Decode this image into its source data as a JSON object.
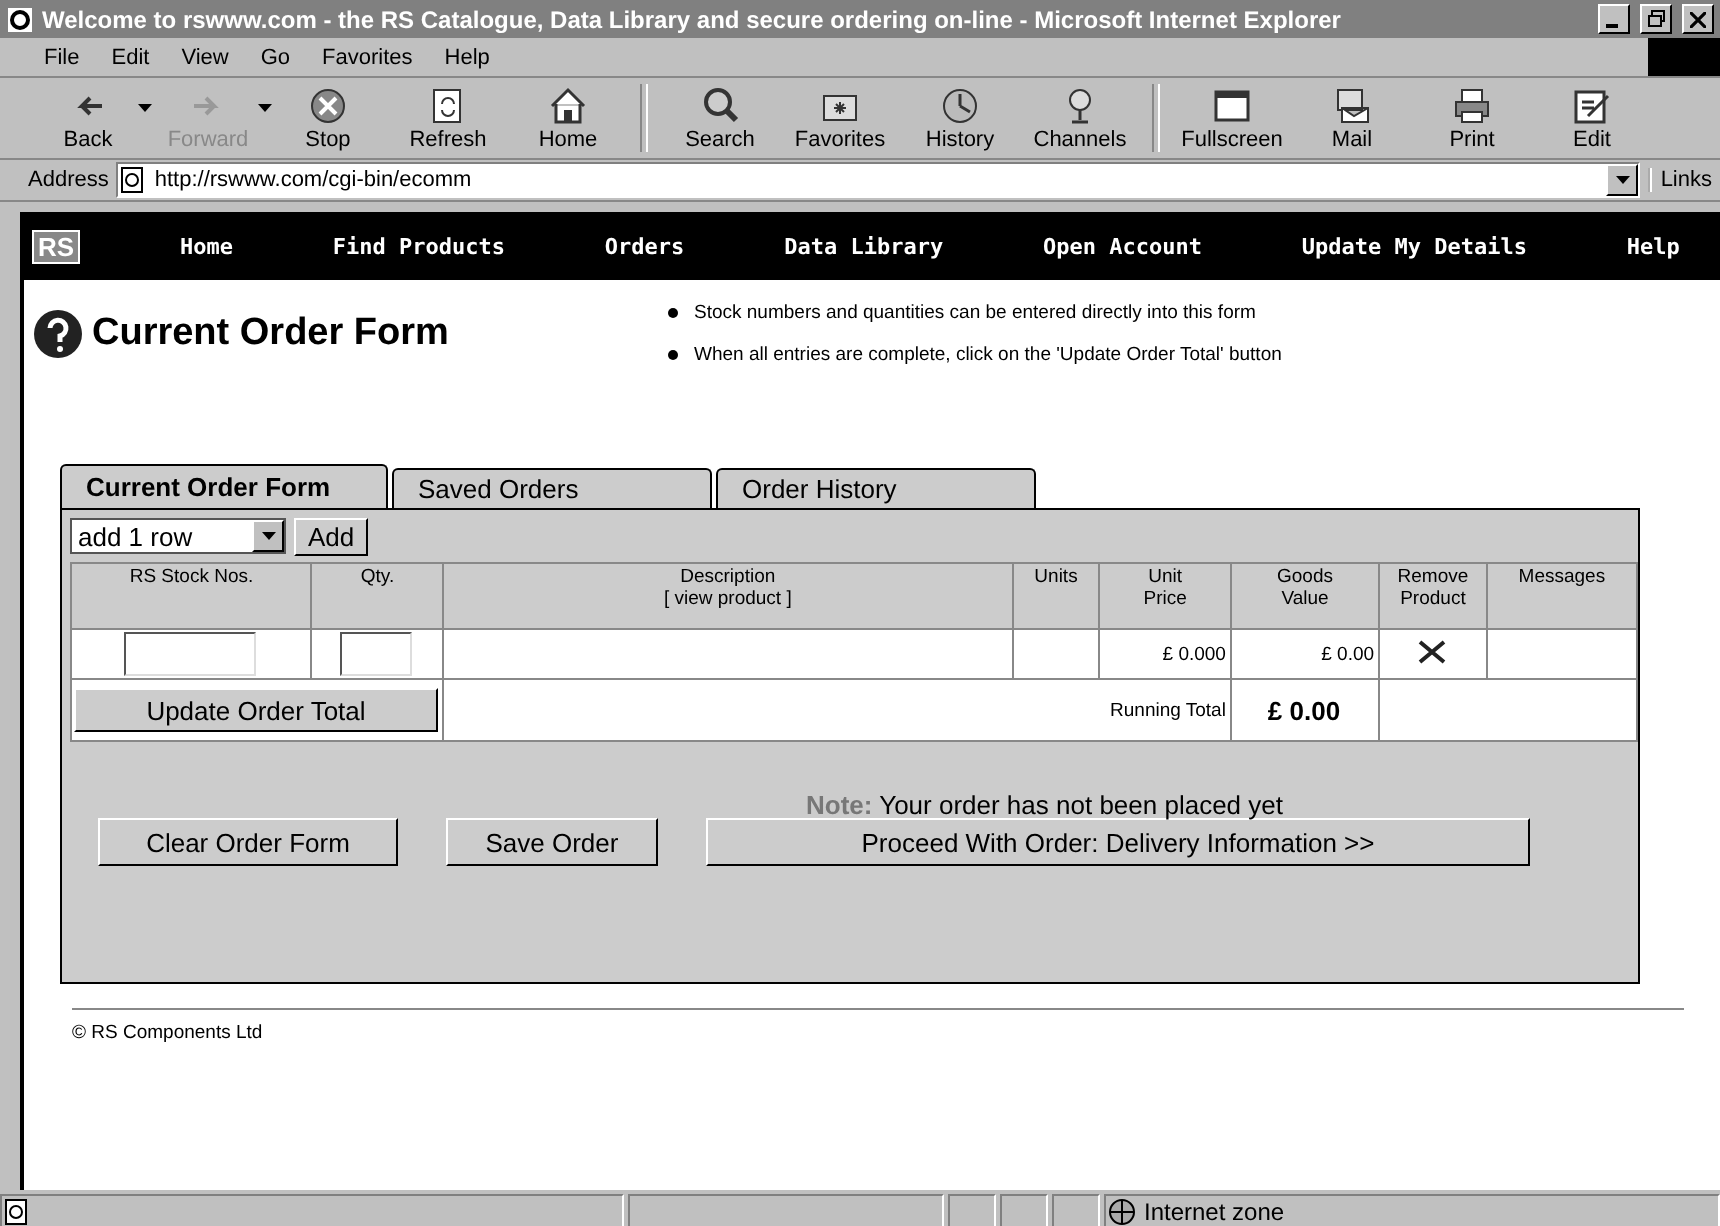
{
  "window": {
    "title": "Welcome to rswww.com - the RS Catalogue, Data Library and secure ordering on-line - Microsoft Internet Explorer"
  },
  "menu": [
    "File",
    "Edit",
    "View",
    "Go",
    "Favorites",
    "Help"
  ],
  "toolbar": [
    {
      "label": "Back",
      "disabled": false,
      "dropdown": true
    },
    {
      "label": "Forward",
      "disabled": true,
      "dropdown": true
    },
    {
      "label": "Stop",
      "disabled": false,
      "dropdown": false
    },
    {
      "label": "Refresh",
      "disabled": false,
      "dropdown": false
    },
    {
      "label": "Home",
      "disabled": false,
      "dropdown": false
    },
    {
      "label": "Search",
      "disabled": false,
      "dropdown": false
    },
    {
      "label": "Favorites",
      "disabled": false,
      "dropdown": false
    },
    {
      "label": "History",
      "disabled": false,
      "dropdown": false
    },
    {
      "label": "Channels",
      "disabled": false,
      "dropdown": false
    },
    {
      "label": "Fullscreen",
      "disabled": false,
      "dropdown": false
    },
    {
      "label": "Mail",
      "disabled": false,
      "dropdown": false
    },
    {
      "label": "Print",
      "disabled": false,
      "dropdown": false
    },
    {
      "label": "Edit",
      "disabled": false,
      "dropdown": false
    }
  ],
  "address": {
    "label": "Address",
    "url": "http://rswww.com/cgi-bin/ecomm",
    "links": "Links"
  },
  "site_nav": {
    "logo": "RS",
    "items": [
      "Home",
      "Find Products",
      "Orders",
      "Data Library",
      "Open Account",
      "Update My Details",
      "Help"
    ]
  },
  "page": {
    "heading": "Current Order Form",
    "bullets": [
      "Stock numbers and quantities can be entered directly into this form",
      "When all entries are complete, click on the 'Update Order Total' button"
    ]
  },
  "tabs": [
    {
      "label": "Current Order Form",
      "selected": true
    },
    {
      "label": "Saved Orders",
      "selected": false
    },
    {
      "label": "Order History",
      "selected": false
    }
  ],
  "add_rows": {
    "select": "add 1 row",
    "button": "Add"
  },
  "table": {
    "columns": [
      {
        "lines": [
          "RS Stock Nos."
        ]
      },
      {
        "lines": [
          "Qty."
        ]
      },
      {
        "lines": [
          "Description",
          "[ view product ]"
        ]
      },
      {
        "lines": [
          "Units"
        ]
      },
      {
        "lines": [
          "Unit",
          "Price"
        ]
      },
      {
        "lines": [
          "Goods",
          "Value"
        ]
      },
      {
        "lines": [
          "Remove",
          "Product"
        ]
      },
      {
        "lines": [
          "Messages"
        ]
      }
    ],
    "rows": [
      {
        "unit_price": "£ 0.000",
        "goods_value": "£ 0.00"
      }
    ],
    "update_button": "Update Order Total",
    "running_total_label": "Running Total",
    "running_total": "£ 0.00"
  },
  "note": "**Note:** Your order has not been placed yet",
  "buttons": [
    "Clear Order Form",
    "Save Order",
    "Proceed With Order: Delivery Information >>"
  ],
  "footer": "© RS Components Ltd",
  "status_bar": {
    "zone": "Internet zone"
  }
}
